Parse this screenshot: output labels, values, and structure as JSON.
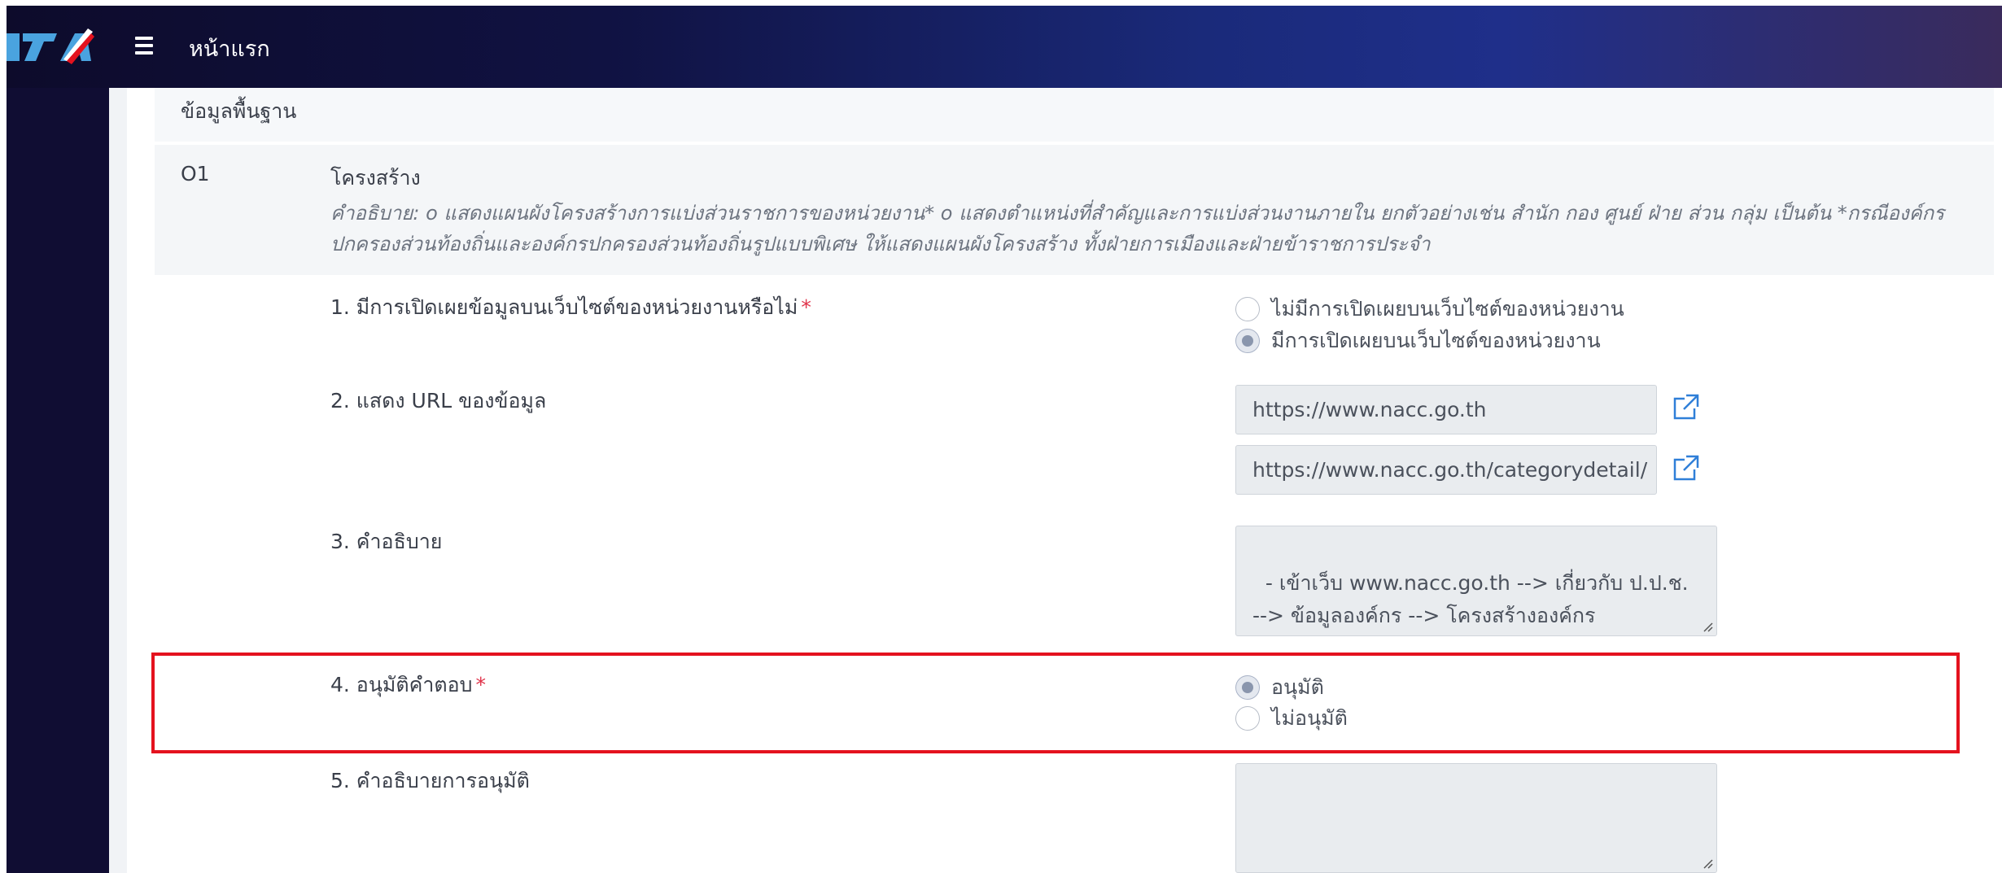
{
  "navbar": {
    "logo_text": "ITA",
    "title": "หน้าแรก"
  },
  "section": {
    "header": "ข้อมูลพื้นฐาน",
    "code": "O1",
    "title": "โครงสร้าง",
    "description": "คำอธิบาย: o แสดงแผนผังโครงสร้างการแบ่งส่วนราชการของหน่วยงาน* o แสดงตำแหน่งที่สำคัญและการแบ่งส่วนงานภายใน ยกตัวอย่างเช่น สำนัก กอง ศูนย์ ฝ่าย ส่วน กลุ่ม เป็นต้น *กรณีองค์กรปกครองส่วนท้องถิ่นและองค์กรปกครองส่วนท้องถิ่นรูปแบบพิเศษ ให้แสดงแผนผังโครงสร้าง ทั้งฝ่ายการเมืองและฝ่ายข้าราชการประจำ"
  },
  "questions": {
    "q1": {
      "label": "1. มีการเปิดเผยข้อมูลบนเว็บไซต์ของหน่วยงานหรือไม่",
      "required_mark": "*",
      "options": [
        "ไม่มีการเปิดเผยบนเว็บไซต์ของหน่วยงาน",
        "มีการเปิดเผยบนเว็บไซต์ของหน่วยงาน"
      ],
      "selected": "มีการเปิดเผยบนเว็บไซต์ของหน่วยงาน"
    },
    "q2": {
      "label": "2. แสดง URL ของข้อมูล",
      "urls": [
        "https://www.nacc.go.th",
        "https://www.nacc.go.th/categorydetail/"
      ]
    },
    "q3": {
      "label": "3. คำอธิบาย",
      "value": "- เข้าเว็บ www.nacc.go.th --> เกี่ยวกับ ป.ป.ช. --> ข้อมูลองค์กร --> โครงสร้างองค์กร"
    },
    "q4": {
      "label": "4. อนุมัติคำตอบ",
      "required_mark": "*",
      "options": [
        "อนุมัติ",
        "ไม่อนุมัติ"
      ],
      "selected": "อนุมัติ"
    },
    "q5": {
      "label": "5. คำอธิบายการอนุมัติ",
      "value": ""
    }
  },
  "colors": {
    "navbar_start": "#0d0b2b",
    "navbar_mid": "#1f2f8a",
    "sidebar": "#100d33",
    "highlight": "#e4121e",
    "required": "#e0334a",
    "link_icon": "#2f7fd8"
  }
}
